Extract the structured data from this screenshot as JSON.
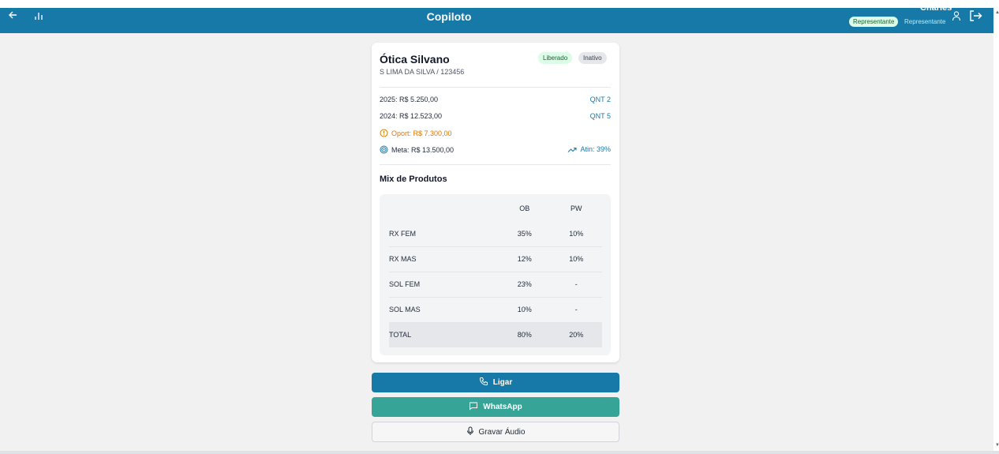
{
  "header": {
    "title": "Copiloto",
    "user_name": "Charles",
    "role_badge": "Representante",
    "role_text": "Representante",
    "back_icon": "arrow-left-icon",
    "chart_icon": "bar-chart-icon",
    "user_icon": "user-icon",
    "logout_icon": "logout-icon"
  },
  "client": {
    "name": "Ótica Silvano",
    "subtitle": "S LIMA DA SILVA / 123456",
    "badges": [
      "Liberado",
      "Inativo"
    ],
    "stats": {
      "y2025": "2025: R$ 5.250,00",
      "y2025_qnt": "QNT 2",
      "y2024": "2024: R$ 12.523,00",
      "y2024_qnt": "QNT 5",
      "oport": "Oport: R$ 7.300,00",
      "meta": "Meta: R$ 13.500,00",
      "atin": "Atin: 39%"
    }
  },
  "mix": {
    "title": "Mix de Produtos",
    "columns": [
      "",
      "OB",
      "PW"
    ],
    "rows": [
      {
        "label": "RX FEM",
        "ob": "35%",
        "pw": "10%"
      },
      {
        "label": "RX MAS",
        "ob": "12%",
        "pw": "10%"
      },
      {
        "label": "SOL FEM",
        "ob": "23%",
        "pw": "-"
      },
      {
        "label": "SOL MAS",
        "ob": "10%",
        "pw": "-"
      },
      {
        "label": "TOTAL",
        "ob": "80%",
        "pw": "20%"
      }
    ]
  },
  "actions": {
    "call": "Ligar",
    "whatsapp": "WhatsApp",
    "audio": "Gravar Áudio"
  },
  "colors": {
    "primary": "#1779a8",
    "whatsapp": "#36a598",
    "opportunity": "#d97706",
    "liberado_bg": "#dcfce7"
  }
}
